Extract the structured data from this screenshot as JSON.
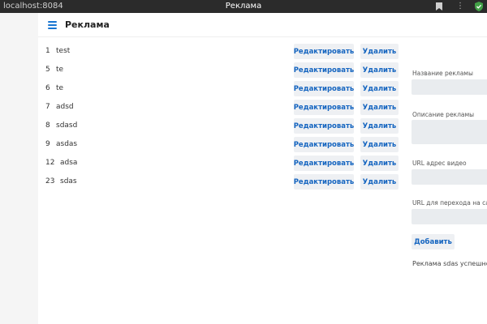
{
  "browser": {
    "url": "localhost:8084",
    "tab_title": "Реклама",
    "bookmark_icon": "bookmark-icon",
    "menu_icon": "kebab-menu-icon",
    "extension_icon": "shield-check-icon"
  },
  "header": {
    "menu_icon": "hamburger-menu-icon",
    "title": "Реклама"
  },
  "ads": [
    {
      "id": "1",
      "name": "test",
      "edit_label": "Редактировать",
      "delete_label": "Удалить"
    },
    {
      "id": "5",
      "name": "te",
      "edit_label": "Редактировать",
      "delete_label": "Удалить"
    },
    {
      "id": "6",
      "name": "te",
      "edit_label": "Редактировать",
      "delete_label": "Удалить"
    },
    {
      "id": "7",
      "name": "adsd",
      "edit_label": "Редактировать",
      "delete_label": "Удалить"
    },
    {
      "id": "8",
      "name": "sdasd",
      "edit_label": "Редактировать",
      "delete_label": "Удалить"
    },
    {
      "id": "9",
      "name": "asdas",
      "edit_label": "Редактировать",
      "delete_label": "Удалить"
    },
    {
      "id": "12",
      "name": "adsa",
      "edit_label": "Редактировать",
      "delete_label": "Удалить"
    },
    {
      "id": "23",
      "name": "sdas",
      "edit_label": "Редактировать",
      "delete_label": "Удалить"
    }
  ],
  "form": {
    "name_label": "Название рекламы",
    "name_value": "",
    "description_label": "Описание рекламы",
    "description_value": "",
    "video_url_label": "URL адрес видео",
    "video_url_value": "",
    "site_url_label": "URL для перехода на сайт",
    "site_url_value": "",
    "add_label": "Добавить",
    "status_message": "Реклама sdas успешно д"
  },
  "colors": {
    "accent": "#1565c0",
    "button_bg": "#eef0f3",
    "input_bg": "#e9ecef",
    "titlebar_bg": "#2b2b2b"
  }
}
